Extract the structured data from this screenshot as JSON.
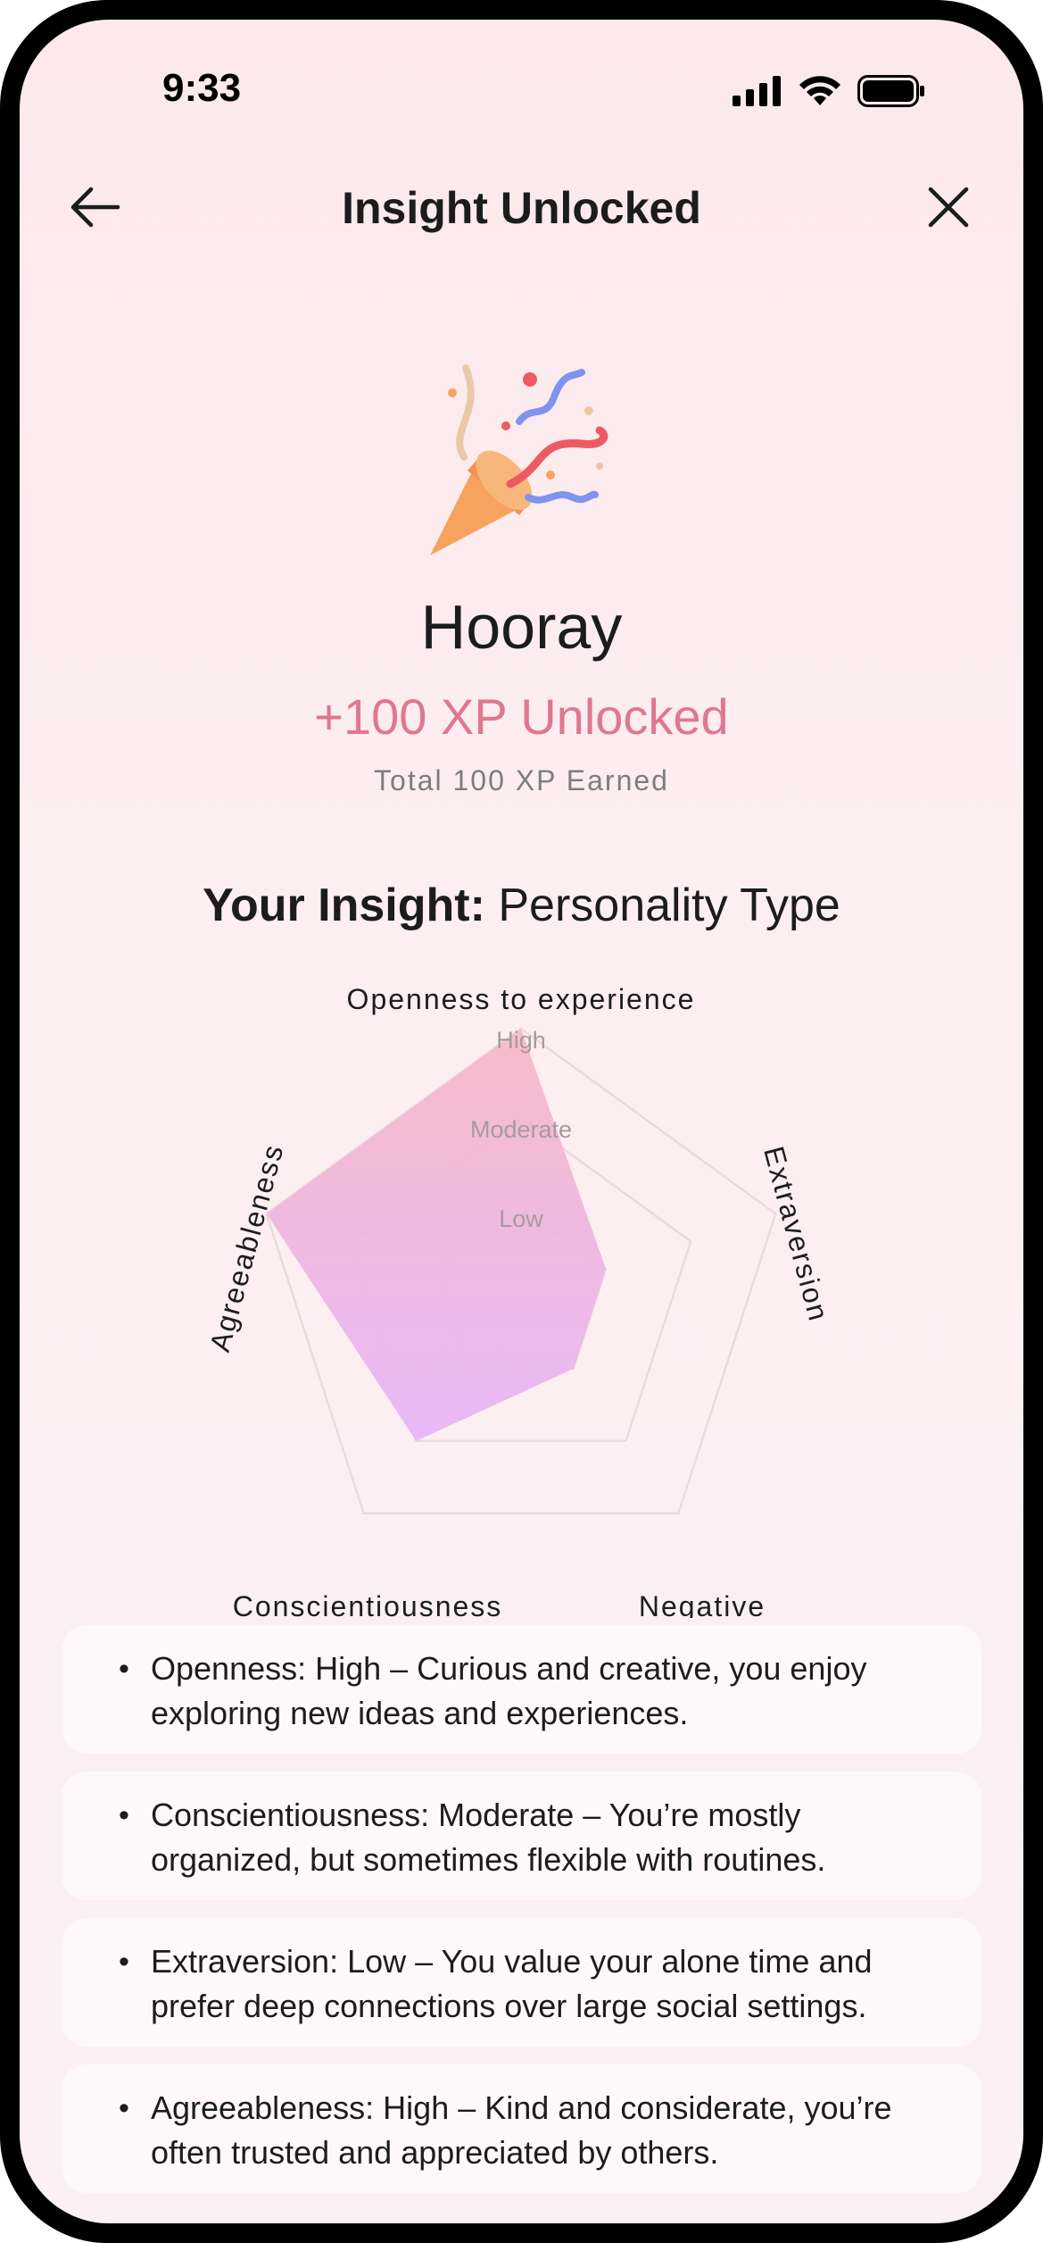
{
  "status_bar": {
    "time": "9:33"
  },
  "nav": {
    "title": "Insight Unlocked"
  },
  "hero": {
    "headline": "Hooray",
    "xp_unlocked": "+100 XP Unlocked",
    "xp_total": "Total 100 XP Earned",
    "insight_label": "Your Insight:",
    "insight_value": "Personality Type"
  },
  "chart_data": {
    "type": "radar",
    "axes": [
      "Openness to experience",
      "Extraversion",
      "Negative",
      "Conscientiousness",
      "Agreeableness"
    ],
    "levels": [
      "Low",
      "Moderate",
      "High"
    ],
    "values": [
      3,
      1,
      1,
      2,
      3
    ],
    "max": 3
  },
  "insights": [
    {
      "text": "Openness: High – Curious and creative, you enjoy exploring new ideas and experiences."
    },
    {
      "text": "Conscientiousness: Moderate – You’re mostly organized, but sometimes flexible with routines."
    },
    {
      "text": "Extraversion: Low – You value your alone time and prefer deep connections over large social settings."
    },
    {
      "text": "Agreeableness: High – Kind and considerate, you’re often trusted and appreciated by others."
    }
  ],
  "colors": {
    "accent": "#e0778e",
    "background": "#fbe9ec",
    "radar_top": "#f7b9c8",
    "radar_bottom": "#e7b6f7"
  }
}
